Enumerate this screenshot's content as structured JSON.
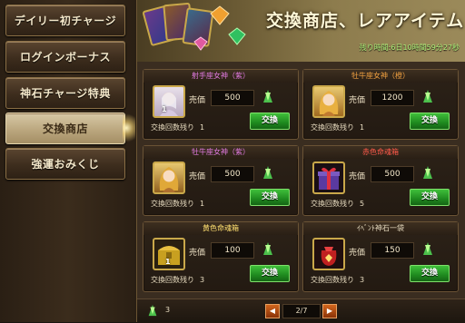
{
  "sidebar": {
    "items": [
      {
        "label": "デイリー初チャージ"
      },
      {
        "label": "ログインボーナス"
      },
      {
        "label": "神石チャージ特典"
      },
      {
        "label": "交換商店"
      },
      {
        "label": "強運おみくじ"
      }
    ]
  },
  "banner": {
    "title": "交換商店、レアアイテム",
    "timer": "残り時間:6日10時間59分27秒"
  },
  "items": [
    {
      "name": "射手座女神（紫）",
      "name_color": "#e07ae0",
      "price_label": "売価",
      "price": "500",
      "remain_label": "交換回数残り",
      "remain": "1",
      "button": "交換",
      "icon": "goddess-portrait-icon"
    },
    {
      "name": "牡牛座女神（橙）",
      "name_color": "#f0a040",
      "price_label": "売価",
      "price": "1200",
      "remain_label": "交換回数残り",
      "remain": "1",
      "button": "交換",
      "icon": "goddess-portrait-icon"
    },
    {
      "name": "牡牛座女神（紫）",
      "name_color": "#e07ae0",
      "price_label": "売価",
      "price": "500",
      "remain_label": "交換回数残り",
      "remain": "1",
      "button": "交換",
      "icon": "goddess-portrait-icon"
    },
    {
      "name": "赤色命魂箱",
      "name_color": "#ff5a4a",
      "price_label": "売価",
      "price": "500",
      "remain_label": "交換回数残り",
      "remain": "5",
      "button": "交換",
      "icon": "gift-box-icon"
    },
    {
      "name": "黄色命魂箱",
      "name_color": "#ffe070",
      "price_label": "売価",
      "price": "100",
      "remain_label": "交換回数残り",
      "remain": "3",
      "button": "交換",
      "icon": "treasure-chest-icon",
      "count": "1"
    },
    {
      "name": "ｲﾍﾞﾝﾄ神石一袋",
      "name_color": "#e8dcc0",
      "price_label": "売価",
      "price": "150",
      "remain_label": "交換回数残り",
      "remain": "3",
      "button": "交換",
      "icon": "gem-bag-icon"
    }
  ],
  "footer": {
    "currency_count": "3",
    "page": "2/7",
    "prev": "◀",
    "next": "▶"
  },
  "colors": {
    "swap_button": "#1f8a1f",
    "accent_gold": "#c9a84a",
    "timer": "#aef27a"
  }
}
